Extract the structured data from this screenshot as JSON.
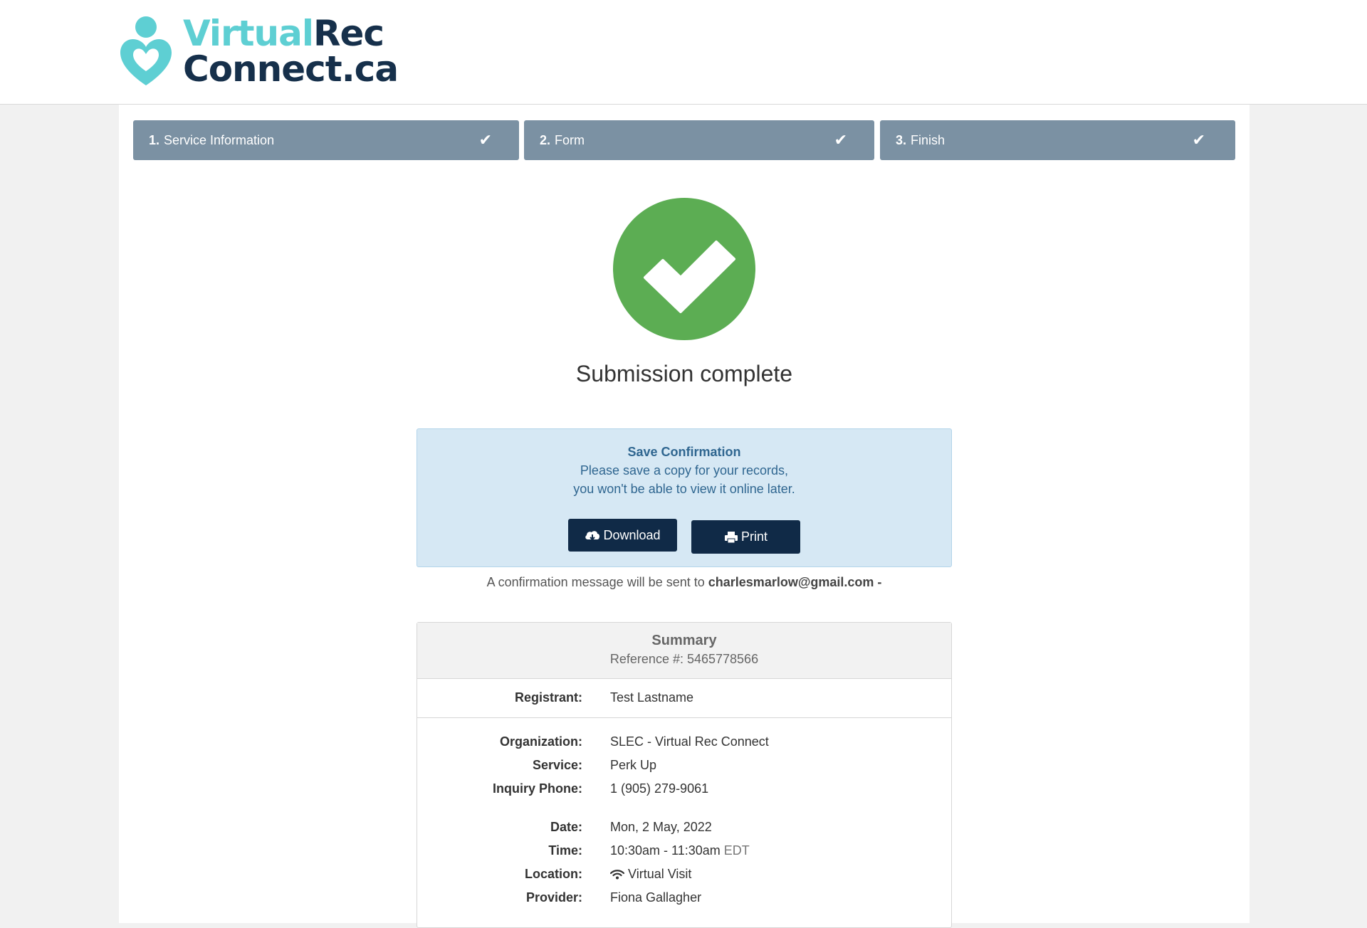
{
  "brand": {
    "name_part1": "Virtual",
    "name_part2": "Rec",
    "name_line2": "Connect.ca",
    "color_teal": "#5ecfd3",
    "color_navy": "#16304b"
  },
  "steps": [
    {
      "number": "1.",
      "label": "Service Information",
      "icon": "check-icon"
    },
    {
      "number": "2.",
      "label": "Form",
      "icon": "check-icon"
    },
    {
      "number": "3.",
      "label": "Finish",
      "icon": "check-icon"
    }
  ],
  "success": {
    "icon": "check-circle-icon",
    "color": "#5cad53",
    "title": "Submission complete"
  },
  "save_confirmation": {
    "title": "Save Confirmation",
    "line1": "Please save a copy for your records,",
    "line2": "you won't be able to view it online later.",
    "download_label": "Download",
    "download_icon": "cloud-download-icon",
    "print_label": "Print",
    "print_icon": "printer-icon"
  },
  "confirmation": {
    "prefix": "A confirmation message will be sent to",
    "email": "charlesmarlow@gmail.com -"
  },
  "summary": {
    "title": "Summary",
    "reference": "Reference #: 5465778566",
    "registrant_label": "Registrant:",
    "registrant_value": "Test Lastname",
    "organization_label": "Organization:",
    "organization_value": "SLEC - Virtual Rec Connect",
    "service_label": "Service:",
    "service_value": "Perk Up",
    "phone_label": "Inquiry Phone:",
    "phone_value": "1 (905) 279-9061",
    "date_label": "Date:",
    "date_value": "Mon, 2 May, 2022",
    "time_label": "Time:",
    "time_value": "10:30am - 11:30am",
    "time_zone": "EDT",
    "location_label": "Location:",
    "location_icon": "wifi-icon",
    "location_value": "Virtual Visit",
    "provider_label": "Provider:",
    "provider_value": "Fiona Gallagher"
  }
}
